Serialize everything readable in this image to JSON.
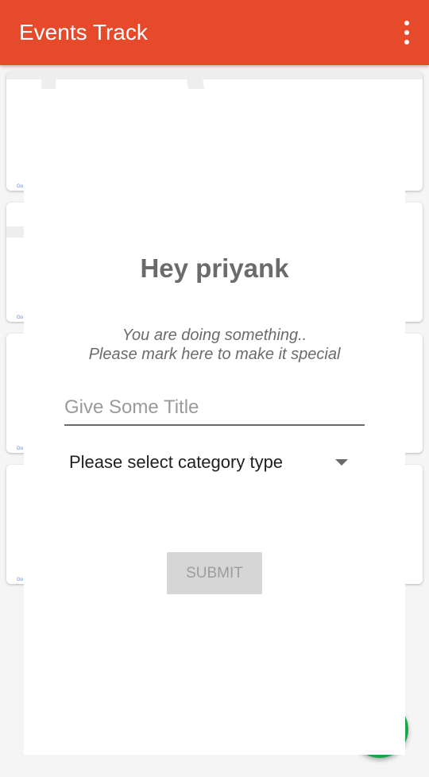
{
  "app_bar": {
    "title": "Events Track",
    "color": "#e64a2b",
    "menu_icon": "more-vert-icon"
  },
  "event_cards": [
    {
      "attribution": "Go"
    },
    {
      "attribution": "Go"
    },
    {
      "attribution": "Go"
    },
    {
      "attribution": "Go"
    }
  ],
  "dialog": {
    "greeting": "Hey priyank",
    "message_line1": "You are doing something..",
    "message_line2": "Please mark here to make it special",
    "title_input": {
      "placeholder": "Give Some Title",
      "value": ""
    },
    "category": {
      "selected": "Please select category type",
      "icon": "dropdown-arrow-icon"
    },
    "submit_label": "SUBMIT"
  },
  "fab": {
    "color": "#1aa548"
  }
}
